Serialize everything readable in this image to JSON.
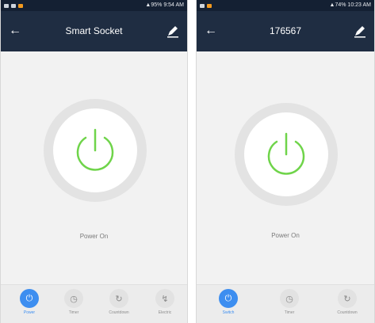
{
  "colors": {
    "status_bar": "#142033",
    "app_bar": "#1f2d42",
    "background": "#f2f2f2",
    "power_green": "#6fd44a",
    "active_blue": "#3d8ef0"
  },
  "left_screen": {
    "status": {
      "right_text": "95% 9:54 AM"
    },
    "header": {
      "back_icon": "arrow-left-icon",
      "title": "Smart Socket",
      "edit_icon": "edit-pencil-icon"
    },
    "power": {
      "icon": "power-icon",
      "label": "Power On"
    },
    "tabs": [
      {
        "label": "Power",
        "icon": "power-icon",
        "active": true
      },
      {
        "label": "Timer",
        "icon": "timer-icon",
        "active": false
      },
      {
        "label": "Countdown",
        "icon": "countdown-icon",
        "active": false
      },
      {
        "label": "Electric",
        "icon": "lightning-icon",
        "active": false
      }
    ]
  },
  "right_screen": {
    "status": {
      "right_text": "74% 10:23 AM"
    },
    "header": {
      "back_icon": "arrow-left-icon",
      "title": "176567",
      "edit_icon": "edit-pencil-icon"
    },
    "power": {
      "icon": "power-icon",
      "label": "Power On"
    },
    "tabs": [
      {
        "label": "Switch",
        "icon": "power-icon",
        "active": true
      },
      {
        "label": "Timer",
        "icon": "timer-icon",
        "active": false
      },
      {
        "label": "Countdown",
        "icon": "countdown-icon",
        "active": false
      }
    ]
  }
}
